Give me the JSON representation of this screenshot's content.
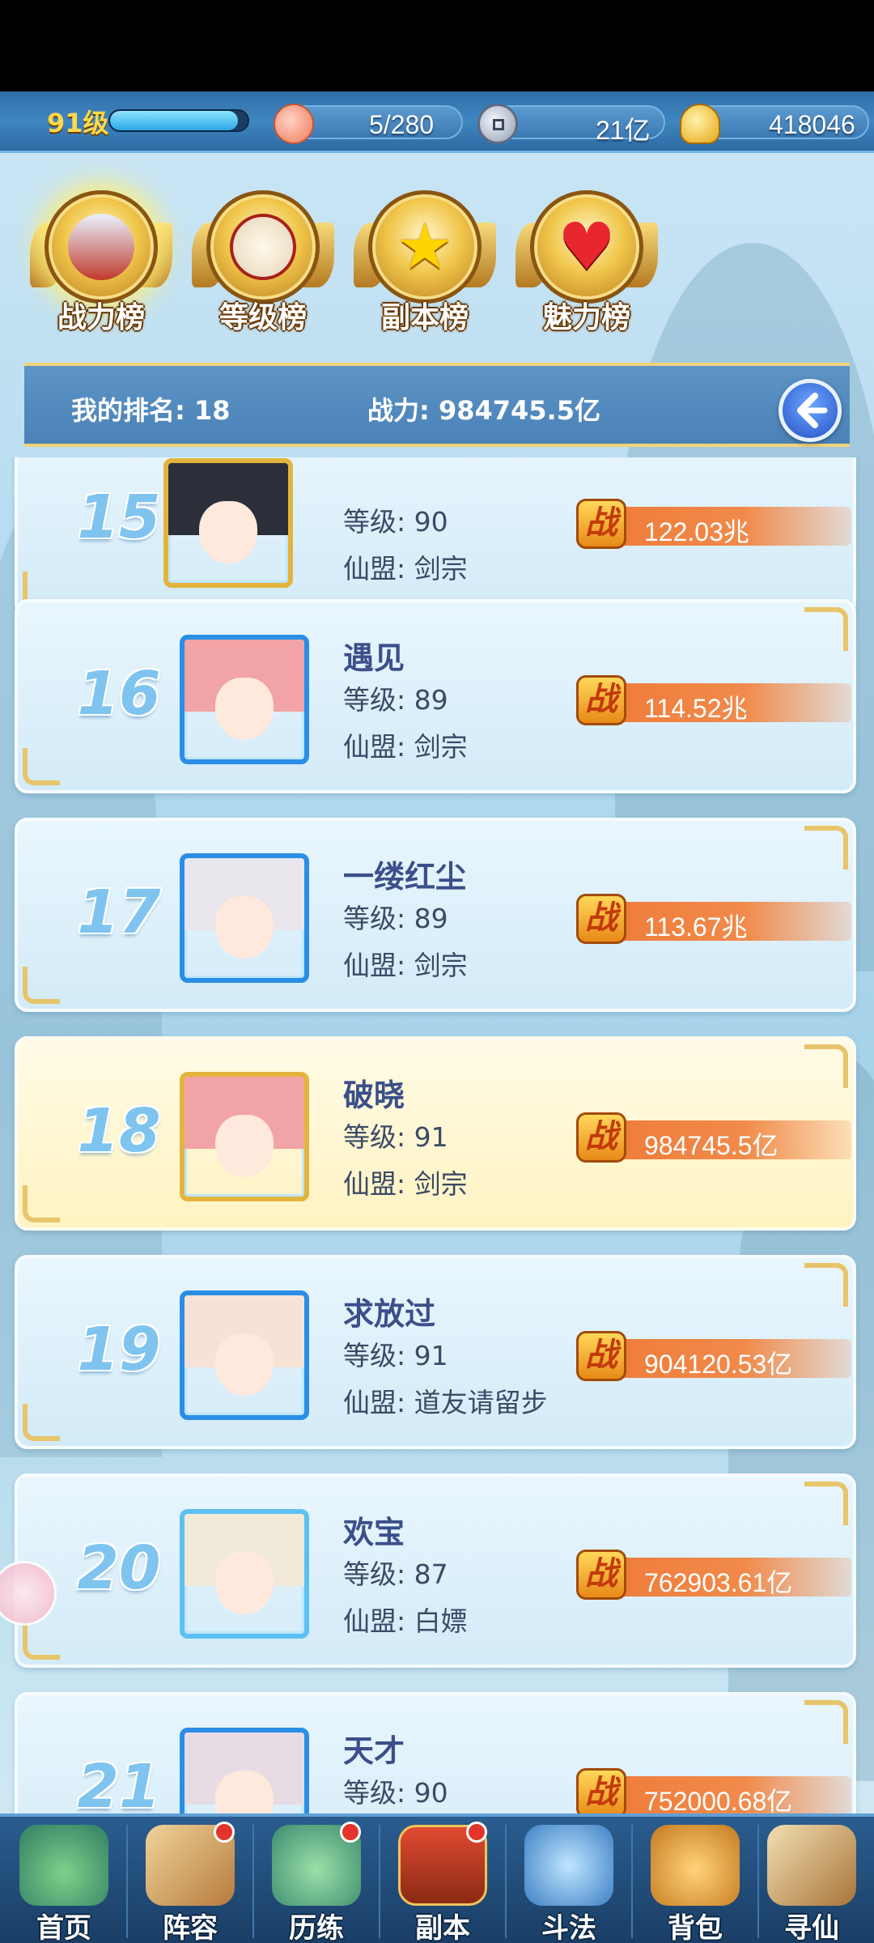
{
  "topbar": {
    "level": "91级",
    "exp_fraction": 0.93,
    "stamina": "5/280",
    "currency1": "21亿",
    "gold": "418046"
  },
  "tabs": [
    {
      "label": "战力榜",
      "active": true
    },
    {
      "label": "等级榜",
      "active": false
    },
    {
      "label": "副本榜",
      "active": false
    },
    {
      "label": "魅力榜",
      "active": false
    }
  ],
  "my_rank": {
    "rank_label": "我的排名: 18",
    "power_label": "战力: 984745.5亿"
  },
  "rows": [
    {
      "rank": "15",
      "name": "",
      "level": "等级: 90",
      "guild": "仙盟: 剑宗",
      "power": "122.03兆",
      "mine": false
    },
    {
      "rank": "16",
      "name": "遇见",
      "level": "等级: 89",
      "guild": "仙盟: 剑宗",
      "power": "114.52兆",
      "mine": false
    },
    {
      "rank": "17",
      "name": "一缕红尘",
      "level": "等级: 89",
      "guild": "仙盟: 剑宗",
      "power": "113.67兆",
      "mine": false
    },
    {
      "rank": "18",
      "name": "破晓",
      "level": "等级: 91",
      "guild": "仙盟: 剑宗",
      "power": "984745.5亿",
      "mine": true
    },
    {
      "rank": "19",
      "name": "求放过",
      "level": "等级: 91",
      "guild": "仙盟: 道友请留步",
      "power": "904120.53亿",
      "mine": false
    },
    {
      "rank": "20",
      "name": "欢宝",
      "level": "等级: 87",
      "guild": "仙盟: 白嫖",
      "power": "762903.61亿",
      "mine": false
    },
    {
      "rank": "21",
      "name": "天才",
      "level": "等级: 90",
      "guild": "",
      "power": "752000.68亿",
      "mine": false
    }
  ],
  "power_icon_text": "战",
  "nav": [
    {
      "label": "首页",
      "badge": false
    },
    {
      "label": "阵容",
      "badge": true
    },
    {
      "label": "历练",
      "badge": true
    },
    {
      "label": "副本",
      "badge": true
    },
    {
      "label": "斗法",
      "badge": false
    },
    {
      "label": "背包",
      "badge": false
    },
    {
      "label": "寻仙",
      "badge": false
    }
  ]
}
